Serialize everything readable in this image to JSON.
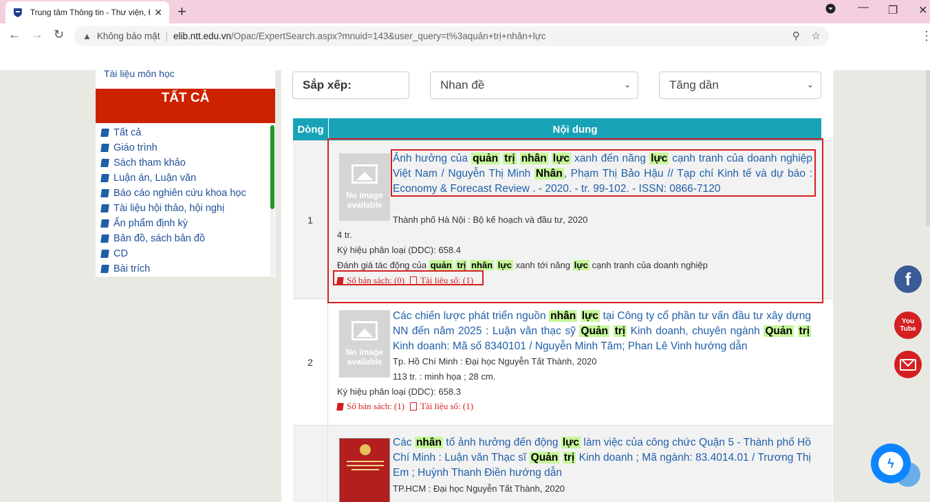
{
  "browser": {
    "tab_title": "Trung tâm Thông tin - Thư viện, Đ",
    "tab_close": "✕",
    "new_tab": "+",
    "not_secure": "Không bảo mật",
    "url_host": "elib.ntt.edu.vn",
    "url_path": "/Opac/ExpertSearch.aspx?mnuid=143&user_query=t%3aquản+trị+nhân+lực"
  },
  "sidebar": {
    "top_item": "Tài liệu môn học",
    "header": "TẤT CẢ",
    "items": [
      {
        "label": "Tất cả"
      },
      {
        "label": "Giáo trình"
      },
      {
        "label": "Sách tham khảo"
      },
      {
        "label": "Luận án, Luận văn"
      },
      {
        "label": "Báo cáo nghiên cứu khoa học"
      },
      {
        "label": "Tài liệu hội thảo, hội nghị"
      },
      {
        "label": "Ấn phẩm định kỳ"
      },
      {
        "label": "Bản đồ, sách bản đồ"
      },
      {
        "label": "CD"
      },
      {
        "label": "Bài trích"
      }
    ]
  },
  "sort": {
    "label": "Sắp xếp:",
    "field": "Nhan đề",
    "order": "Tăng dần"
  },
  "table": {
    "col_row": "Dòng",
    "col_content": "Nội dung"
  },
  "results": [
    {
      "num": "1",
      "no_image": [
        "No image",
        "available"
      ],
      "title_parts": [
        {
          "t": "Ảnh hưởng của ",
          "hl": false
        },
        {
          "t": "quản",
          "hl": true
        },
        {
          "t": " ",
          "hl": false
        },
        {
          "t": "trị",
          "hl": true
        },
        {
          "t": " ",
          "hl": false
        },
        {
          "t": "nhân",
          "hl": true
        },
        {
          "t": " ",
          "hl": false
        },
        {
          "t": "lực",
          "hl": true
        },
        {
          "t": " xanh đến năng ",
          "hl": false
        },
        {
          "t": "lực",
          "hl": true
        },
        {
          "t": " cạnh tranh của doanh nghiệp Việt Nam / Nguyễn Thị Minh ",
          "hl": false
        },
        {
          "t": "Nhân",
          "hl": true
        },
        {
          "t": ", Phạm Thị Bảo Hậu // Tạp chí Kinh tế và dự báo : Economy & Forecast Review . - 2020. - tr. 99-102. - ISSN: 0866-7120",
          "hl": false
        }
      ],
      "publisher": "Thành phố Hà Nội : Bộ kế hoạch và đầu tư, 2020",
      "pages": "4 tr.",
      "ddc": "Ký hiệu phân loại (DDC): 658.4",
      "subject_parts": [
        {
          "t": "Đánh giá tác động của ",
          "hl": false
        },
        {
          "t": "quản",
          "hl": true
        },
        {
          "t": " ",
          "hl": false
        },
        {
          "t": "trị",
          "hl": true
        },
        {
          "t": " ",
          "hl": false
        },
        {
          "t": "nhân",
          "hl": true
        },
        {
          "t": " ",
          "hl": false
        },
        {
          "t": "lực",
          "hl": true
        },
        {
          "t": " xanh tới năng ",
          "hl": false
        },
        {
          "t": "lực",
          "hl": true
        },
        {
          "t": " cạnh tranh của doanh nghiệp",
          "hl": false
        }
      ],
      "copies": "Số bản sách: (0)",
      "digital": "Tài liệu số: (1)"
    },
    {
      "num": "2",
      "no_image": [
        "No image",
        "available"
      ],
      "title_parts": [
        {
          "t": "Các chiến lược phát triển nguồn ",
          "hl": false
        },
        {
          "t": "nhân",
          "hl": true
        },
        {
          "t": " ",
          "hl": false
        },
        {
          "t": "lực",
          "hl": true
        },
        {
          "t": " tại Công ty cổ phần tư vấn đầu tư xây dựng NN đến năm 2025 : Luận văn thạc sỹ ",
          "hl": false
        },
        {
          "t": "Quản",
          "hl": true
        },
        {
          "t": " ",
          "hl": false
        },
        {
          "t": "trị",
          "hl": true
        },
        {
          "t": " Kinh doanh, chuyên ngành ",
          "hl": false
        },
        {
          "t": "Quản",
          "hl": true
        },
        {
          "t": " ",
          "hl": false
        },
        {
          "t": "trị",
          "hl": true
        },
        {
          "t": " Kinh doanh: Mã số 8340101 / Nguyễn Minh Tâm; Phan Lê Vinh hướng dẫn",
          "hl": false
        }
      ],
      "publisher": "Tp. Hồ Chí Minh : Đại học Nguyễn Tất Thành, 2020",
      "pages": "113 tr. : minh họa ; 28 cm.",
      "ddc": "Ký hiệu phân loại (DDC): 658.3",
      "copies": "Số bản sách: (1)",
      "digital": "Tài liệu số: (1)"
    },
    {
      "num": "3",
      "title_parts": [
        {
          "t": "Các ",
          "hl": false
        },
        {
          "t": "nhân",
          "hl": true
        },
        {
          "t": " tố ảnh hưởng đến động ",
          "hl": false
        },
        {
          "t": "lực",
          "hl": true
        },
        {
          "t": " làm việc của công chức Quận 5 - Thành phố Hồ Chí Minh : Luận văn Thạc sĩ ",
          "hl": false
        },
        {
          "t": "Quản",
          "hl": true
        },
        {
          "t": " ",
          "hl": false
        },
        {
          "t": "trị",
          "hl": true
        },
        {
          "t": " Kinh doanh ; Mã ngành: 83.4014.01 / Trương Thị Em ; Huỳnh Thanh Điền hướng dẫn",
          "hl": false
        }
      ],
      "publisher": "TP.HCM : Đại học Nguyễn Tất Thành, 2020"
    }
  ],
  "social": {
    "facebook": "f",
    "youtube": "You Tube"
  }
}
